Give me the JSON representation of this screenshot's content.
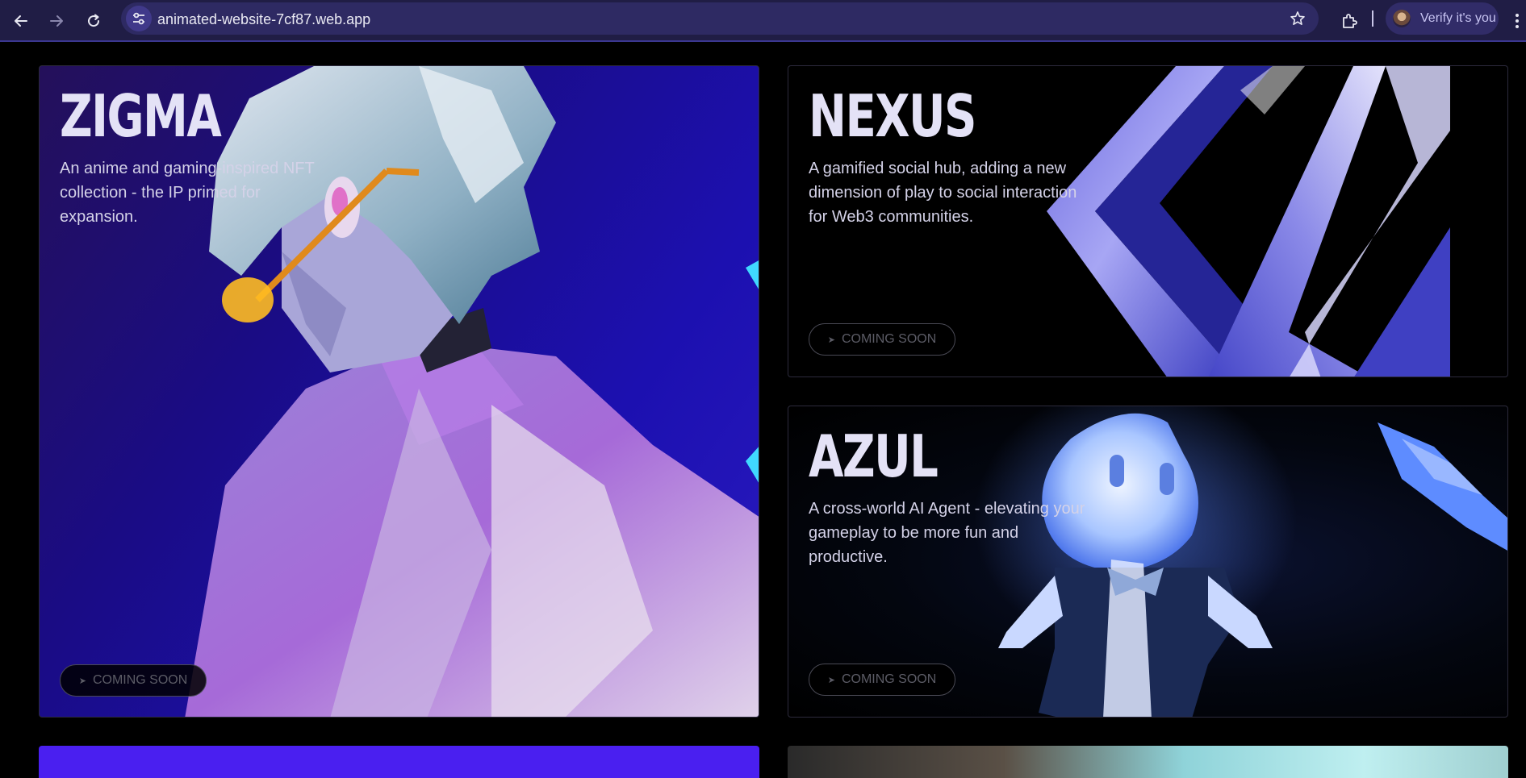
{
  "browser": {
    "url": "animated-website-7cf87.web.app",
    "profile_label": "Verify it's you",
    "icons": [
      "back-arrow-icon",
      "forward-arrow-icon",
      "reload-icon",
      "site-settings-icon",
      "bookmark-star-icon",
      "extensions-puzzle-icon",
      "kebab-menu-icon"
    ]
  },
  "cards": {
    "zigma": {
      "title": "ZIGMA",
      "description": "An anime and gaming-inspired NFT collection - the IP primed for expansion.",
      "button_label": "COMING SOON"
    },
    "nexus": {
      "title": "NEXUS",
      "description": "A gamified social hub, adding a new dimension of play to social interaction for Web3 communities.",
      "button_label": "COMING SOON"
    },
    "azul": {
      "title": "AZUL",
      "description": "A cross-world AI Agent - elevating your gameplay to be more fun and productive.",
      "button_label": "COMING SOON"
    }
  },
  "colors": {
    "page_bg": "#000000",
    "chrome_bg": "#201d45",
    "title_text": "#e4e2f6",
    "zigma_bg": "#1a0c85",
    "accent_purple": "#4a1ff0"
  }
}
